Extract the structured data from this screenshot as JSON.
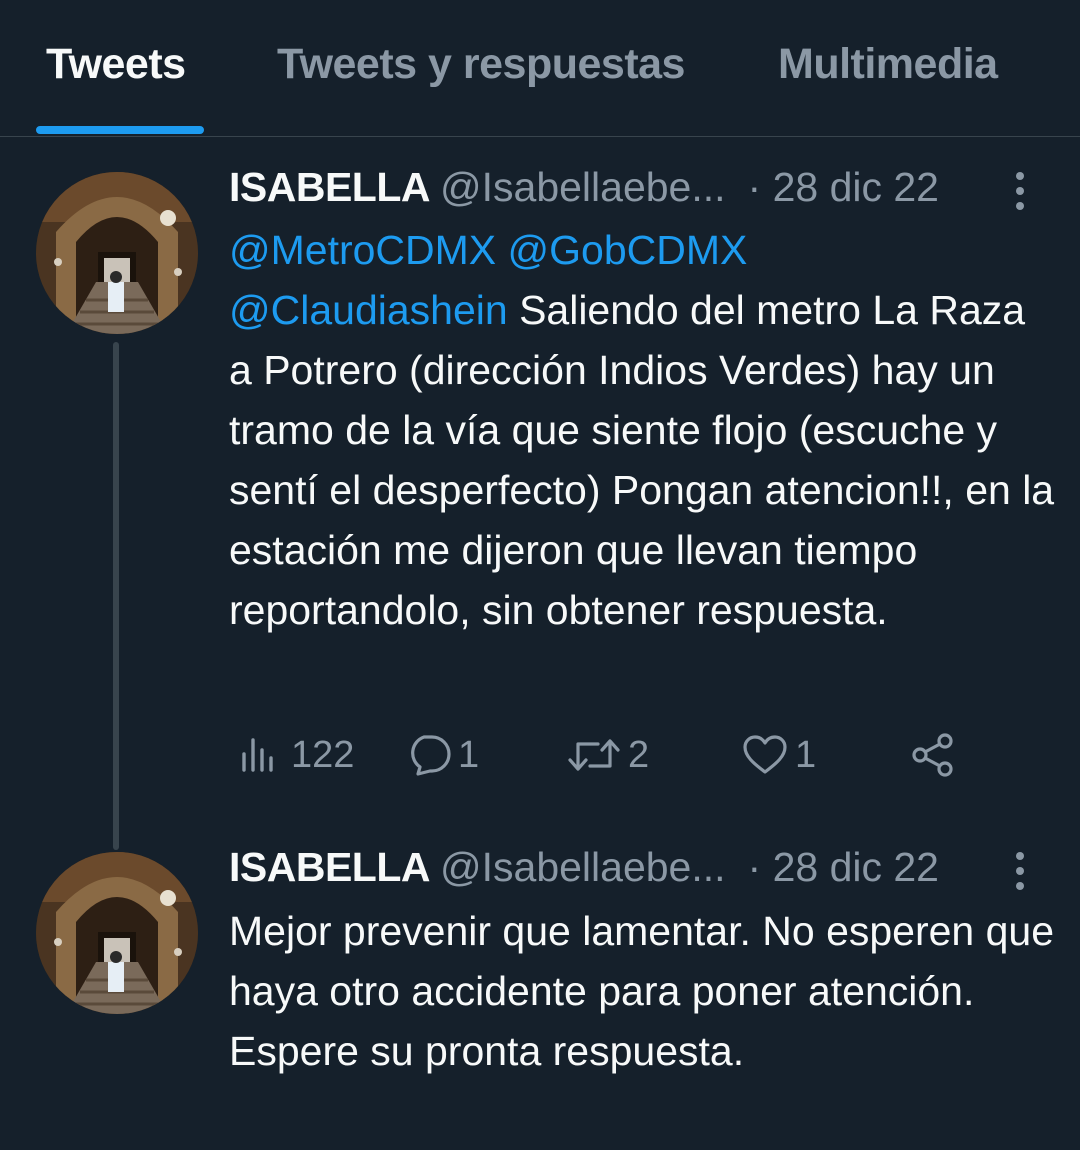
{
  "tabs": [
    {
      "label": "Tweets",
      "active": true
    },
    {
      "label": "Tweets y respuestas",
      "active": false
    },
    {
      "label": "Multimedia",
      "active": false
    }
  ],
  "colors": {
    "accent": "#1d9bf0",
    "background": "#15202b",
    "secondary_text": "#8b98a5"
  },
  "tweets": [
    {
      "name": "ISABELLA",
      "handle": "@Isabellaebe...",
      "date": "· 28 dic 22",
      "mentions": [
        "@MetroCDMX",
        "@GobCDMX",
        "@Claudiashein"
      ],
      "text_line_1": " Saliendo del metro La",
      "text_rest": "Raza a Potrero (dirección Indios Verdes) hay un tramo de la vía que siente flojo (escuche y sentí el desperfecto) Pongan atencion!!, en la estación me dijeron que llevan tiempo reportandolo, sin obtener respuesta.",
      "stats": {
        "views": "122",
        "replies": "1",
        "retweets": "2",
        "likes": "1"
      }
    },
    {
      "name": "ISABELLA",
      "handle": "@Isabellaebe...",
      "date": "· 28 dic 22",
      "text": "Mejor prevenir que lamentar. No esperen que haya otro accidente para poner atención.",
      "text_2": "Espere su pronta respuesta."
    }
  ]
}
